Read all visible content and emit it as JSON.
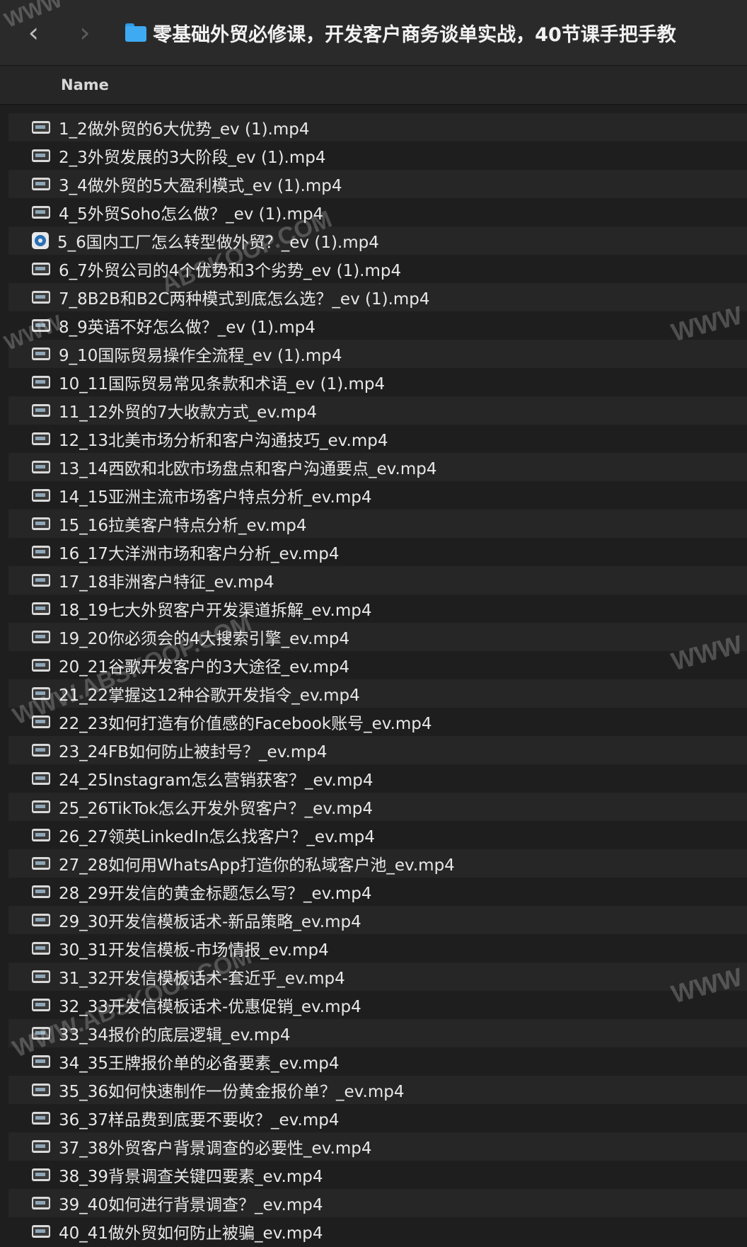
{
  "toolbar": {
    "back_label": "‹",
    "forward_label": "›",
    "folder_icon": "folder-icon",
    "title": "零基础外贸必修课，开发客户商务谈单实战，40节课手把手教"
  },
  "columns": {
    "name": "Name"
  },
  "files": [
    {
      "name": "1_2做外贸的6大优势_ev (1).mp4",
      "icon": "video-file-icon"
    },
    {
      "name": "2_3外贸发展的3大阶段_ev (1).mp4",
      "icon": "video-file-icon"
    },
    {
      "name": "3_4做外贸的5大盈利模式_ev (1).mp4",
      "icon": "video-file-icon"
    },
    {
      "name": "4_5外贸Soho怎么做？_ev (1).mp4",
      "icon": "video-file-icon"
    },
    {
      "name": "5_6国内工厂怎么转型做外贸？_ev (1).mp4",
      "icon": "quicktime-file-icon"
    },
    {
      "name": "6_7外贸公司的4个优势和3个劣势_ev (1).mp4",
      "icon": "video-file-icon"
    },
    {
      "name": "7_8B2B和B2C两种模式到底怎么选？_ev (1).mp4",
      "icon": "video-file-icon"
    },
    {
      "name": "8_9英语不好怎么做？_ev (1).mp4",
      "icon": "video-file-icon"
    },
    {
      "name": "9_10国际贸易操作全流程_ev (1).mp4",
      "icon": "video-file-icon"
    },
    {
      "name": "10_11国际贸易常见条款和术语_ev (1).mp4",
      "icon": "video-file-icon"
    },
    {
      "name": "11_12外贸的7大收款方式_ev.mp4",
      "icon": "video-file-icon"
    },
    {
      "name": "12_13北美市场分析和客户沟通技巧_ev.mp4",
      "icon": "video-file-icon"
    },
    {
      "name": "13_14西欧和北欧市场盘点和客户沟通要点_ev.mp4",
      "icon": "video-file-icon"
    },
    {
      "name": "14_15亚洲主流市场客户特点分析_ev.mp4",
      "icon": "video-file-icon"
    },
    {
      "name": "15_16拉美客户特点分析_ev.mp4",
      "icon": "video-file-icon"
    },
    {
      "name": "16_17大洋洲市场和客户分析_ev.mp4",
      "icon": "video-file-icon"
    },
    {
      "name": "17_18非洲客户特征_ev.mp4",
      "icon": "video-file-icon"
    },
    {
      "name": "18_19七大外贸客户开发渠道拆解_ev.mp4",
      "icon": "video-file-icon"
    },
    {
      "name": "19_20你必须会的4大搜索引擎_ev.mp4",
      "icon": "video-file-icon"
    },
    {
      "name": "20_21谷歌开发客户的3大途径_ev.mp4",
      "icon": "video-file-icon"
    },
    {
      "name": "21_22掌握这12种谷歌开发指令_ev.mp4",
      "icon": "video-file-icon"
    },
    {
      "name": "22_23如何打造有价值感的Facebook账号_ev.mp4",
      "icon": "video-file-icon"
    },
    {
      "name": "23_24FB如何防止被封号？_ev.mp4",
      "icon": "video-file-icon"
    },
    {
      "name": "24_25Instagram怎么营销获客？_ev.mp4",
      "icon": "video-file-icon"
    },
    {
      "name": "25_26TikTok怎么开发外贸客户？_ev.mp4",
      "icon": "video-file-icon"
    },
    {
      "name": "26_27领英LinkedIn怎么找客户？_ev.mp4",
      "icon": "video-file-icon"
    },
    {
      "name": "27_28如何用WhatsApp打造你的私域客户池_ev.mp4",
      "icon": "video-file-icon"
    },
    {
      "name": "28_29开发信的黄金标题怎么写？_ev.mp4",
      "icon": "video-file-icon"
    },
    {
      "name": "29_30开发信模板话术-新品策略_ev.mp4",
      "icon": "video-file-icon"
    },
    {
      "name": "30_31开发信模板-市场情报_ev.mp4",
      "icon": "video-file-icon"
    },
    {
      "name": "31_32开发信模板话术-套近乎_ev.mp4",
      "icon": "video-file-icon"
    },
    {
      "name": "32_33开发信模板话术-优惠促销_ev.mp4",
      "icon": "video-file-icon"
    },
    {
      "name": "33_34报价的底层逻辑_ev.mp4",
      "icon": "video-file-icon"
    },
    {
      "name": "34_35王牌报价单的必备要素_ev.mp4",
      "icon": "video-file-icon"
    },
    {
      "name": "35_36如何快速制作一份黄金报价单？_ev.mp4",
      "icon": "video-file-icon"
    },
    {
      "name": "36_37样品费到底要不要收？_ev.mp4",
      "icon": "video-file-icon"
    },
    {
      "name": "37_38外贸客户背景调查的必要性_ev.mp4",
      "icon": "video-file-icon"
    },
    {
      "name": "38_39背景调查关键四要素_ev.mp4",
      "icon": "video-file-icon"
    },
    {
      "name": "39_40如何进行背景调查？_ev.mp4",
      "icon": "video-file-icon"
    },
    {
      "name": "40_41做外贸如何防止被骗_ev.mp4",
      "icon": "video-file-icon"
    }
  ],
  "watermarks": {
    "short": "WWW",
    "long": "WWW.ABSKOOP.COM",
    "site": "ABSKOOP.COM"
  }
}
